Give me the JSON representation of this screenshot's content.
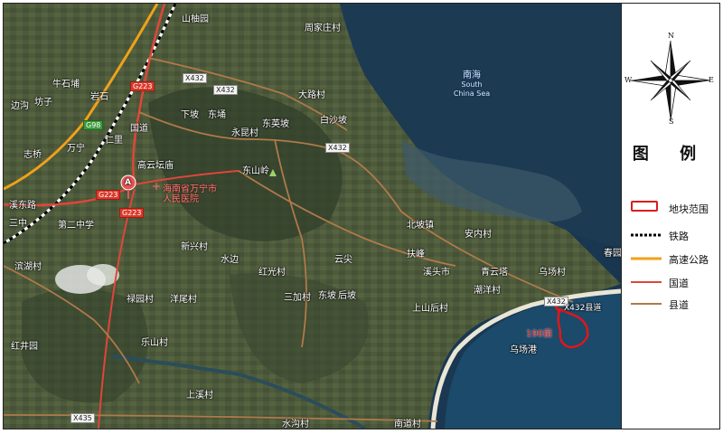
{
  "map": {
    "places": [
      {
        "name": "山柚园",
        "cls": ""
      },
      {
        "name": "周家庄村",
        "cls": ""
      },
      {
        "name": "大路村",
        "cls": ""
      },
      {
        "name": "白沙坡",
        "cls": ""
      },
      {
        "name": "东英坡",
        "cls": ""
      },
      {
        "name": "永昆村",
        "cls": ""
      },
      {
        "name": "下坡",
        "cls": ""
      },
      {
        "name": "东埇",
        "cls": ""
      },
      {
        "name": "东山岭",
        "cls": ""
      },
      {
        "name": "高云坛庙",
        "cls": ""
      },
      {
        "name": "仁里",
        "cls": ""
      },
      {
        "name": "国道",
        "cls": ""
      },
      {
        "name": "牛石埔",
        "cls": ""
      },
      {
        "name": "岩石",
        "cls": ""
      },
      {
        "name": "坊子",
        "cls": ""
      },
      {
        "name": "边沟",
        "cls": ""
      },
      {
        "name": "万宁",
        "cls": ""
      },
      {
        "name": "志桥",
        "cls": ""
      },
      {
        "name": "新兴村",
        "cls": ""
      },
      {
        "name": "水边",
        "cls": ""
      },
      {
        "name": "红光村",
        "cls": ""
      },
      {
        "name": "云尖",
        "cls": ""
      },
      {
        "name": "北坡镇",
        "cls": ""
      },
      {
        "name": "安内村",
        "cls": ""
      },
      {
        "name": "扶峰",
        "cls": ""
      },
      {
        "name": "溪头市",
        "cls": ""
      },
      {
        "name": "青云塔",
        "cls": ""
      },
      {
        "name": "乌场村",
        "cls": ""
      },
      {
        "name": "潮洋村",
        "cls": ""
      },
      {
        "name": "上山后村",
        "cls": ""
      },
      {
        "name": "东坡",
        "cls": ""
      },
      {
        "name": "后坡",
        "cls": ""
      },
      {
        "name": "三加村",
        "cls": ""
      },
      {
        "name": "洋尾村",
        "cls": ""
      },
      {
        "name": "禄园村",
        "cls": ""
      },
      {
        "name": "乐山村",
        "cls": ""
      },
      {
        "name": "滨湖村",
        "cls": ""
      },
      {
        "name": "红井园",
        "cls": ""
      },
      {
        "name": "上溪村",
        "cls": ""
      },
      {
        "name": "水沟村",
        "cls": ""
      },
      {
        "name": "南道村",
        "cls": ""
      },
      {
        "name": "乌场港",
        "cls": ""
      },
      {
        "name": "春园",
        "cls": ""
      },
      {
        "name": "第二中学",
        "cls": ""
      },
      {
        "name": "三中",
        "cls": ""
      },
      {
        "name": "溪东路",
        "cls": ""
      },
      {
        "name": "红光村",
        "cls": ""
      }
    ],
    "sea_name": "南海",
    "sea_name_en": "South China Sea",
    "hospital": "海南省万宁市人民医院",
    "marker_letter": "A",
    "shields": [
      "X432",
      "X432",
      "X432",
      "G223",
      "G223",
      "G223",
      "G98",
      "X435",
      "X432",
      "X432县道"
    ],
    "site_label": "190亩",
    "site_label_color": "#e0161b"
  },
  "legend": {
    "title": "图 例",
    "items": [
      {
        "key": "plot",
        "label": "地块范围",
        "color": "#d81e1e"
      },
      {
        "key": "railway",
        "label": "铁路",
        "color": "#000000"
      },
      {
        "key": "expressway",
        "label": "高速公路",
        "color": "#f0a11a"
      },
      {
        "key": "national",
        "label": "国道",
        "color": "#e0463a"
      },
      {
        "key": "county",
        "label": "县道",
        "color": "#b07a4a"
      }
    ],
    "compass": {
      "n": "N",
      "s": "S",
      "e": "E",
      "w": "W"
    }
  }
}
